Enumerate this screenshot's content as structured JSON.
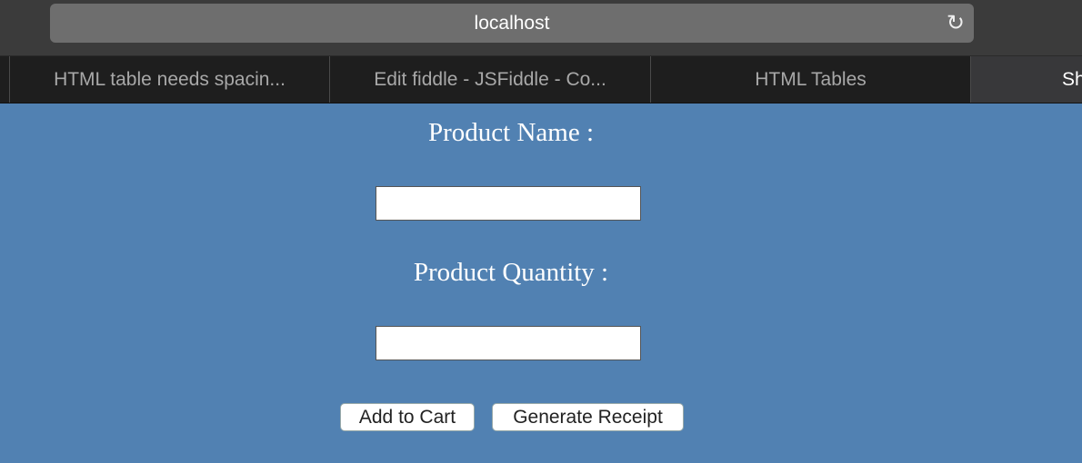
{
  "browser": {
    "address": "localhost",
    "reload_icon": "reload-icon",
    "tabs": [
      {
        "label": "HTML table needs spacin..."
      },
      {
        "label": "Edit fiddle - JSFiddle - Co..."
      },
      {
        "label": "HTML Tables"
      },
      {
        "label": "Sh",
        "active": true
      }
    ]
  },
  "form": {
    "product_name_label": "Product Name :",
    "product_name_value": "",
    "product_quantity_label": "Product Quantity :",
    "product_quantity_value": "",
    "add_to_cart": "Add to Cart",
    "generate_receipt": "Generate Receipt"
  },
  "colors": {
    "page_background": "#5181b2"
  }
}
